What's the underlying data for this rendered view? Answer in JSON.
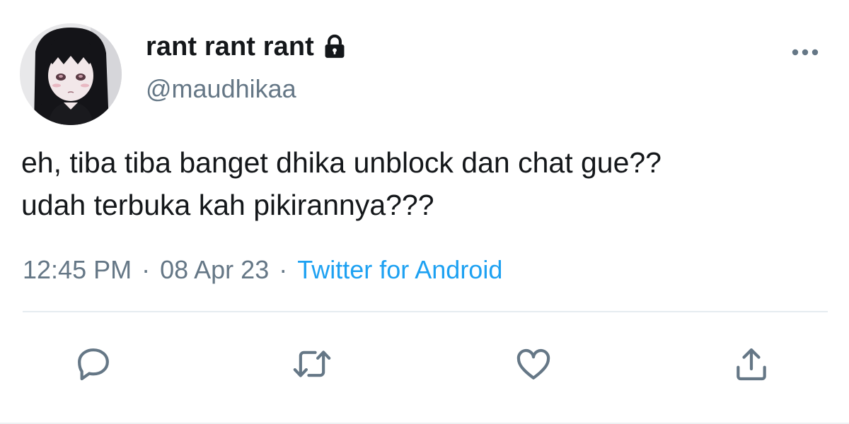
{
  "tweet": {
    "display_name": "rant rant rant",
    "handle": "@maudhikaa",
    "protected_icon": "lock-icon",
    "text": "eh, tiba tiba banget dhika unblock dan chat gue??\nudah terbuka kah pikirannya???",
    "time": "12:45 PM",
    "separator1": "·",
    "date": "08 Apr 23",
    "separator2": "·",
    "source": "Twitter for Android"
  },
  "actions": {
    "reply_icon": "speech-bubble-icon",
    "retweet_icon": "retweet-arrows-icon",
    "like_icon": "heart-icon",
    "share_icon": "share-arrow-icon",
    "more_icon": "three-dots-icon"
  },
  "colors": {
    "text_primary": "#14171a",
    "text_secondary": "#657786",
    "link_blue": "#1da1f2",
    "icon_gray": "#657786",
    "divider": "#e6ecf0"
  }
}
